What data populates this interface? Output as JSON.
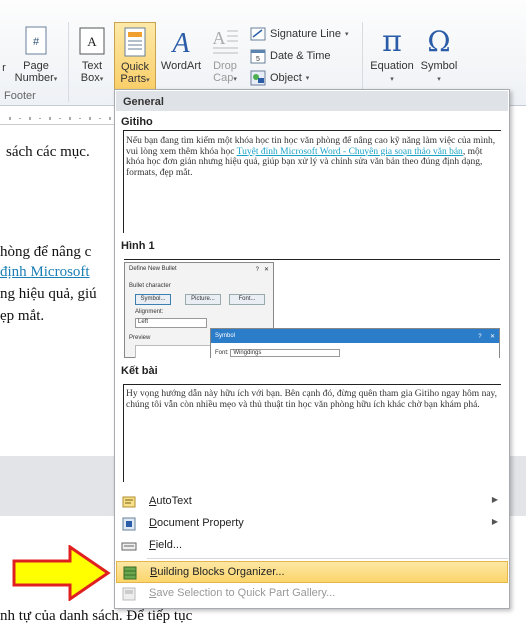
{
  "ribbon": {
    "footer_group": "Footer",
    "left_partial": "r",
    "page_number": {
      "line1": "Page",
      "line2": "Number"
    },
    "text_box": {
      "line1": "Text",
      "line2": "Box"
    },
    "quick_parts": {
      "line1": "Quick",
      "line2": "Parts"
    },
    "wordart": {
      "line1": "WordArt"
    },
    "drop_cap": {
      "line1": "Drop",
      "line2": "Cap"
    },
    "signature_line": "Signature Line",
    "date_time": "Date & Time",
    "object": "Object",
    "equation": "Equation",
    "symbol": "Symbol",
    "caret": "▾"
  },
  "document": {
    "line1": "sách các mục.",
    "line2": "hòng để nâng c",
    "line3": "định Microsoft",
    "line4": "ng hiệu quả, giú",
    "line5": "ẹp mắt.",
    "bottom_line": "nh tự của danh sách. Để tiếp tục"
  },
  "panel": {
    "header": "General",
    "gallery": [
      {
        "title": "Gitiho",
        "text_before": "Nếu bạn đang tìm kiếm một khóa học tin học văn phòng để nâng cao kỹ năng làm việc của mình, vui lòng xem thêm khóa học ",
        "link": "Tuyệt đỉnh Microsoft Word - Chuyên gia soạn thảo văn bản",
        "text_after": ", một khóa học đơn giản nhưng hiệu quả, giúp bạn  xử lý và chỉnh sửa văn bản theo đúng định dạng, formats, đẹp mắt."
      },
      {
        "title": "Hình 1",
        "dlg1_title": "Define New Bullet",
        "dlg1_section": "Bullet character",
        "dlg1_btn1": "Symbol...",
        "dlg1_btn2": "Picture...",
        "dlg1_btn3": "Font...",
        "dlg1_align_label": "Alignment:",
        "dlg1_align_value": "Left",
        "dlg1_preview": "Preview",
        "dlg2_title": "Symbol",
        "dlg2_font_label": "Font:",
        "dlg2_font_value": "Wingdings",
        "dlg_q": "?",
        "dlg_x": "✕"
      },
      {
        "title": "Kết bài",
        "text": "Hy vọng hướng dẫn này hữu ích với bạn. Bên cạnh đó, đừng quên tham gia Gitiho ngay hôm nay, chúng tôi vẫn còn nhiều mẹo và thủ thuật tin học văn phòng hữu ích khác chờ bạn khám phá."
      }
    ],
    "menu": [
      {
        "label": "AutoText",
        "mnemonic": "A",
        "rest": "utoText",
        "submenu": "▶"
      },
      {
        "label": "Document Property",
        "mnemonic": "D",
        "rest": "ocument Property",
        "submenu": "▶"
      },
      {
        "label": "Field...",
        "mnemonic": "F",
        "rest": "ield..."
      },
      {
        "label": "Building Blocks Organizer...",
        "mnemonic": "B",
        "rest": "uilding Blocks Organizer..."
      },
      {
        "label": "Save Selection to Quick Part Gallery...",
        "mnemonic": "S",
        "rest": "ave Selection to Quick Part Gallery..."
      }
    ]
  },
  "colors": {
    "highlight": "#fcd56b",
    "arrow_fill": "#ffff00",
    "arrow_stroke": "#e02020",
    "link": "#1a7fb5"
  }
}
